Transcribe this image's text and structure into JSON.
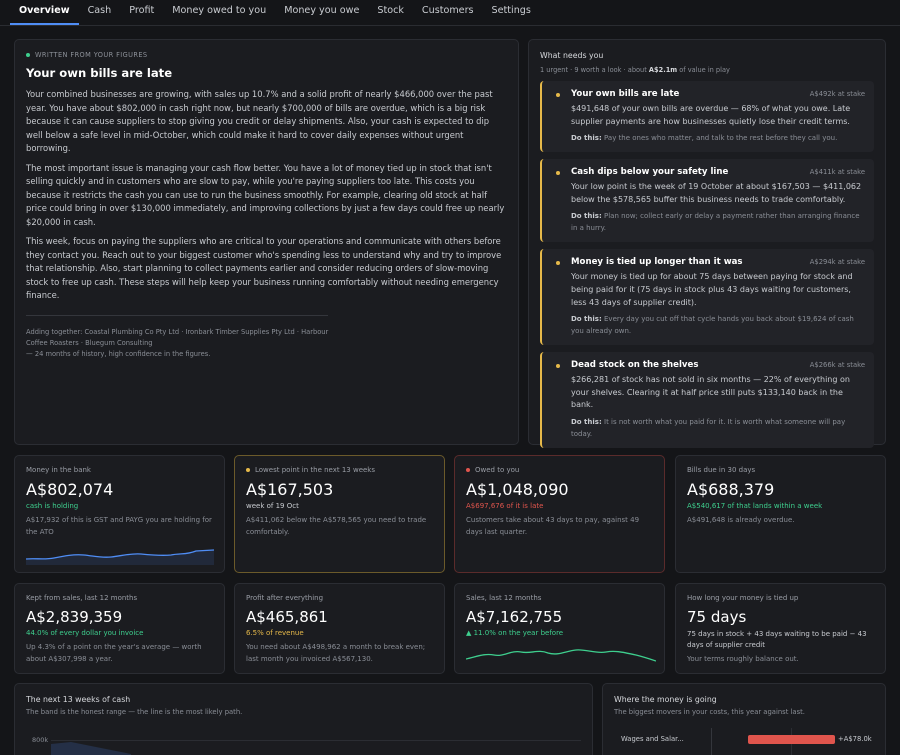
{
  "nav": {
    "tabs": [
      {
        "label": "Overview"
      },
      {
        "label": "Cash"
      },
      {
        "label": "Profit"
      },
      {
        "label": "Money owed to you"
      },
      {
        "label": "Money you owe"
      },
      {
        "label": "Stock"
      },
      {
        "label": "Customers"
      },
      {
        "label": "Settings"
      }
    ]
  },
  "summary": {
    "eyebrow": "WRITTEN FROM YOUR FIGURES",
    "title": "Your own bills are late",
    "paragraphs": [
      "Your combined businesses are growing, with sales up 10.7% and a solid profit of nearly $466,000 over the past year. You have about $802,000 in cash right now, but nearly $700,000 of bills are overdue, which is a big risk because it can cause suppliers to stop giving you credit or delay shipments. Also, your cash is expected to dip well below a safe level in mid-October, which could make it hard to cover daily expenses without urgent borrowing.",
      "The most important issue is managing your cash flow better. You have a lot of money tied up in stock that isn't selling quickly and in customers who are slow to pay, while you're paying suppliers too late. This costs you because it restricts the cash you can use to run the business smoothly. For example, clearing old stock at half price could bring in over $130,000 immediately, and improving collections by just a few days could free up nearly $20,000 in cash.",
      "This week, focus on paying the suppliers who are critical to your operations and communicate with others before they contact you. Reach out to your biggest customer who's spending less to understand why and try to improve that relationship. Also, start planning to collect payments earlier and consider reducing orders of slow-moving stock to free up cash. These steps will help keep your business running comfortably without needing emergency finance."
    ],
    "sources_line1": "Adding together: Coastal Plumbing Co Pty Ltd · Ironbark Timber Supplies Pty Ltd · Harbour",
    "sources_line2": "Coffee Roasters · Bluegum Consulting",
    "sources_line3": "— 24 months of history, high confidence in the figures."
  },
  "needs": {
    "title": "What needs you",
    "sub_prefix": "1 urgent · 9 worth a look · about ",
    "sub_amount": "A$2.1m",
    "sub_suffix": " of value in play",
    "items": [
      {
        "title": "Your own bills are late",
        "stake": "A$492k at stake",
        "body": "$491,648 of your own bills are overdue — 68% of what you owe. Late supplier payments are how businesses quietly lose their credit terms.",
        "do_label": "Do this:",
        "do_text": "Pay the ones who matter, and talk to the rest before they call you."
      },
      {
        "title": "Cash dips below your safety line",
        "stake": "A$411k at stake",
        "body": "Your low point is the week of 19 October at about $167,503 — $411,062 below the $578,565 buffer this business needs to trade comfortably.",
        "do_label": "Do this:",
        "do_text": "Plan now; collect early or delay a payment rather than arranging finance in a hurry."
      },
      {
        "title": "Money is tied up longer than it was",
        "stake": "A$294k at stake",
        "body": "Your money is tied up for about 75 days between paying for stock and being paid for it (75 days in stock plus 43 days waiting for customers, less 43 days of supplier credit).",
        "do_label": "Do this:",
        "do_text": "Every day you cut off that cycle hands you back about $19,624 of cash you already own."
      },
      {
        "title": "Dead stock on the shelves",
        "stake": "A$266k at stake",
        "body": "$266,281 of stock has not sold in six months — 22% of everything on your shelves. Clearing it at half price still puts $133,140 back in the bank.",
        "do_label": "Do this:",
        "do_text": "It is not worth what you paid for it. It is worth what someone will pay today."
      }
    ]
  },
  "metrics": [
    {
      "label": "Money in the bank",
      "value": "A$802,074",
      "note": "cash is holding",
      "desc": "A$17,932 of this is GST and PAYG you are holding for the ATO"
    },
    {
      "label": "Lowest point in the next 13 weeks",
      "value": "A$167,503",
      "note": "week of 19 Oct",
      "desc": "A$411,062 below the A$578,565 you need to trade comfortably."
    },
    {
      "label": "Owed to you",
      "value": "A$1,048,090",
      "note": "A$697,676 of it is late",
      "desc": "Customers take about 43 days to pay, against 49 days last quarter."
    },
    {
      "label": "Bills due in 30 days",
      "value": "A$688,379",
      "note": "A$540,617 of that lands within a week",
      "desc": "A$491,648 is already overdue."
    },
    {
      "label": "Kept from sales, last 12 months",
      "value": "A$2,839,359",
      "note": "44.0% of every dollar you invoice",
      "desc": "Up 4.3% of a point on the year's average — worth about A$307,998 a year."
    },
    {
      "label": "Profit after everything",
      "value": "A$465,861",
      "note": "6.5% of revenue",
      "desc": "You need about A$498,962 a month to break even; last month you invoiced A$567,130."
    },
    {
      "label": "Sales, last 12 months",
      "value": "A$7,162,755",
      "note": "▲ 11.0% on the year before",
      "desc": ""
    },
    {
      "label": "How long your money is tied up",
      "value": "75 days",
      "note": "75 days in stock + 43 days waiting to be paid − 43 days of supplier credit",
      "desc": "Your terms roughly balance out."
    }
  ],
  "cash_weeks": {
    "title": "The next 13 weeks of cash",
    "sub": "The band is the honest range — the line is the most likely path.",
    "tick_label": "800k"
  },
  "money_going": {
    "title": "Where the money is going",
    "sub": "The biggest movers in your costs, this year against last.",
    "bar_label": "Wages and Salar...",
    "bar_value": "+A$78.0k"
  },
  "colors": {
    "accent": "#4f8df5",
    "good": "#3ecf8e",
    "warn": "#e6b94a",
    "bad": "#e0554d"
  }
}
